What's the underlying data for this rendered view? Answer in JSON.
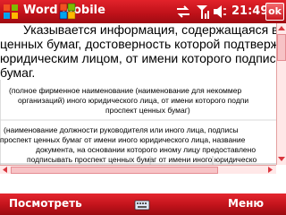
{
  "titlebar": {
    "app_title": "Word Mobile",
    "clock": "21:49",
    "ok_label": "ok"
  },
  "document": {
    "lines": [
      "Указывается информация, содержащаяся в наст",
      "ценных бумаг, достоверность которой подтверждает",
      "юридическим лицом, от имени которого подписыва",
      "бумаг.",
      "(полное фирменное наименование (наименование для некоммер",
      "организаций) иного юридического лица, от имени которого подпи",
      "проспект ценных бумаг)",
      "(наименование должности руководителя или иного лица, подписы",
      "проспект ценных бумаг от имени иного юридического лица, название",
      "документа, на основании которого иному лицу предоставлено",
      "подписывать проспект ценных бумаг от имени иного юридическо"
    ]
  },
  "menubar": {
    "left_softkey": "Посмотреть",
    "right_softkey": "Меню"
  },
  "colors": {
    "bar_red": "#c1121a",
    "scroll_bg": "#ffe8e8",
    "scroll_thumb": "#f7c3c6"
  },
  "icons": [
    "windows-start-icon",
    "sync-icon",
    "signal-icon",
    "volume-icon",
    "keyboard-icon"
  ]
}
